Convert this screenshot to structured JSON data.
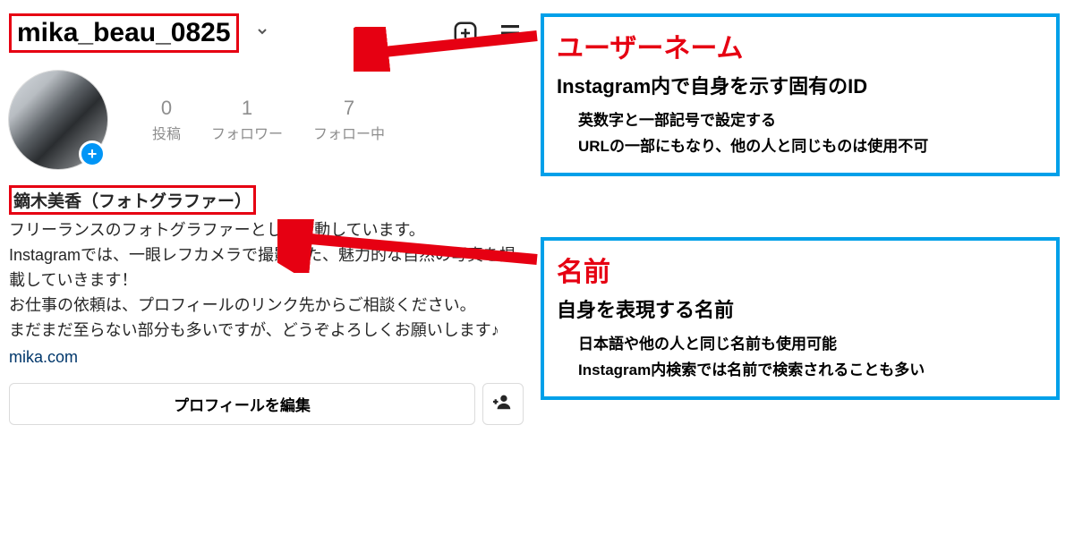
{
  "profile": {
    "username": "mika_beau_0825",
    "display_name": "鏑木美香（フォトグラファー）",
    "bio_line1": "フリーランスのフォトグラファーとして活動しています。",
    "bio_line2": "Instagramでは、一眼レフカメラで撮影した、魅力的な自然の写真を掲載していきます！",
    "bio_line3": "お仕事の依頼は、プロフィールのリンク先からご相談ください。",
    "bio_line4": "まだまだ至らない部分も多いですが、どうぞよろしくお願いします♪",
    "link": "mika.com",
    "stats": {
      "posts_count": "0",
      "posts_label": "投稿",
      "followers_count": "1",
      "followers_label": "フォロワー",
      "following_count": "7",
      "following_label": "フォロー中"
    },
    "edit_button": "プロフィールを編集"
  },
  "annotations": {
    "username": {
      "title": "ユーザーネーム",
      "subtitle": "Instagram内で自身を示す固有のID",
      "note1": "英数字と一部記号で設定する",
      "note2": "URLの一部にもなり、他の人と同じものは使用不可"
    },
    "name": {
      "title": "名前",
      "subtitle": "自身を表現する名前",
      "note1": "日本語や他の人と同じ名前も使用可能",
      "note2": "Instagram内検索では名前で検索されることも多い"
    }
  }
}
